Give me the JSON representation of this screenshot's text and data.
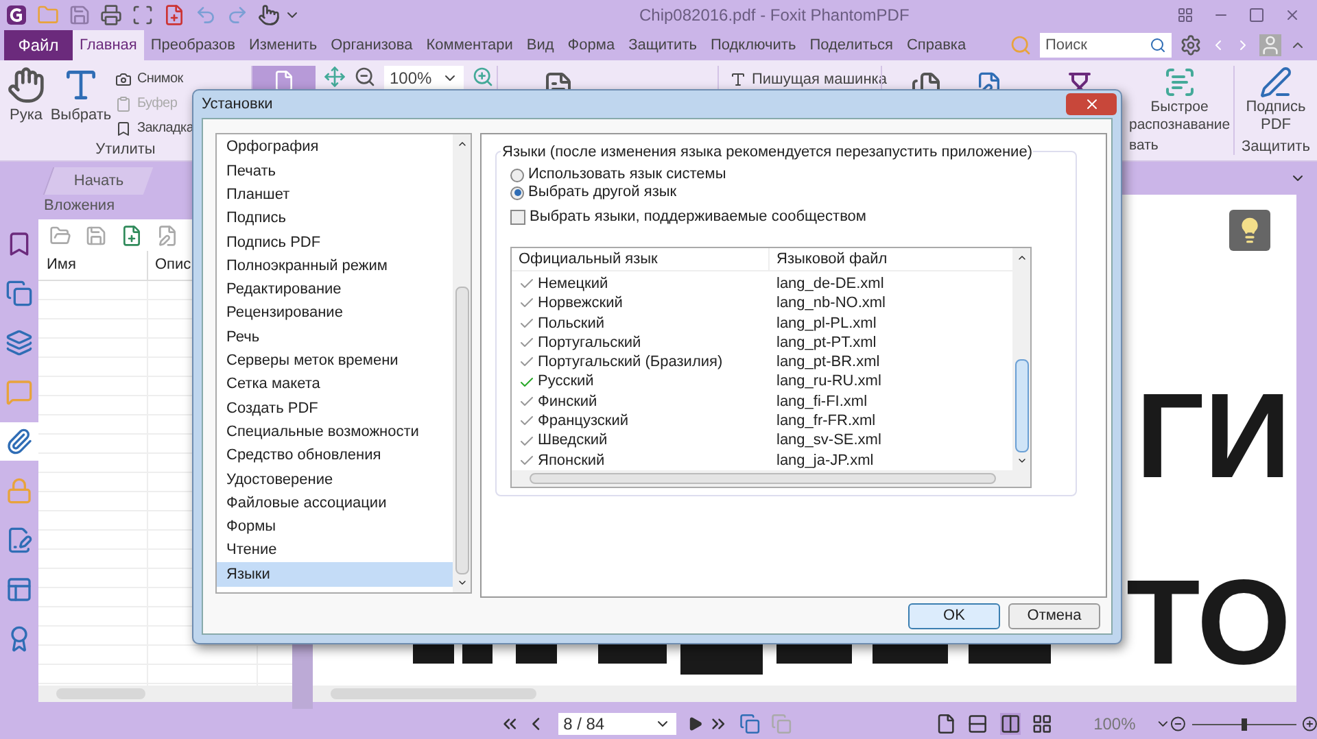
{
  "window": {
    "title": "Chip082016.pdf - Foxit PhantomPDF"
  },
  "menu_tabs": [
    {
      "label": "Файл",
      "kind": "file",
      "selected": false
    },
    {
      "label": "Главная",
      "kind": "tab",
      "selected": true
    },
    {
      "label": "Преобразов",
      "kind": "tab",
      "selected": false
    },
    {
      "label": "Изменить",
      "kind": "tab",
      "selected": false
    },
    {
      "label": "Организова",
      "kind": "tab",
      "selected": false
    },
    {
      "label": "Комментари",
      "kind": "tab",
      "selected": false
    },
    {
      "label": "Вид",
      "kind": "tab",
      "selected": false
    },
    {
      "label": "Форма",
      "kind": "tab",
      "selected": false
    },
    {
      "label": "Защитить",
      "kind": "tab",
      "selected": false
    },
    {
      "label": "Подключить",
      "kind": "tab",
      "selected": false
    },
    {
      "label": "Поделиться",
      "kind": "tab",
      "selected": false
    },
    {
      "label": "Справка",
      "kind": "tab",
      "selected": false
    }
  ],
  "search": {
    "placeholder": "Поиск"
  },
  "ribbon": {
    "hand": "Рука",
    "select": "Выбрать",
    "small_tools": [
      {
        "label": "Снимок",
        "disabled": false
      },
      {
        "label": "Буфер",
        "disabled": true
      },
      {
        "label": "Закладка",
        "disabled": false
      }
    ],
    "utilities_group": "Утилиты",
    "zoom": "100%",
    "typewriter": "Пишущая машинка",
    "ocr_lines": [
      "Быстрое",
      "распознавание"
    ],
    "recognize_group": "вать",
    "sign_lines": [
      "Подпись",
      "PDF"
    ],
    "protect_group": "Защитить"
  },
  "doc_tab": {
    "label": "Начать"
  },
  "sidebar": {
    "items": [
      {
        "kind": "bookmarks",
        "selected": false
      },
      {
        "kind": "pages",
        "selected": false
      },
      {
        "kind": "layers",
        "selected": false
      },
      {
        "kind": "comments",
        "selected": false
      },
      {
        "kind": "attachments",
        "selected": true
      },
      {
        "kind": "security",
        "selected": false
      },
      {
        "kind": "signatures",
        "selected": false
      },
      {
        "kind": "forms",
        "selected": false
      },
      {
        "kind": "certify",
        "selected": false
      }
    ]
  },
  "panel": {
    "title": "Вложения",
    "columns": [
      "Имя",
      "Опис"
    ]
  },
  "document": {
    "lines": [
      "ГИ",
      "ТО"
    ]
  },
  "dialog": {
    "title": "Установки",
    "categories": [
      {
        "label": "Орфография",
        "selected": false
      },
      {
        "label": "Печать",
        "selected": false
      },
      {
        "label": "Планшет",
        "selected": false
      },
      {
        "label": "Подпись",
        "selected": false
      },
      {
        "label": "Подпись PDF",
        "selected": false
      },
      {
        "label": "Полноэкранный режим",
        "selected": false
      },
      {
        "label": "Редактирование",
        "selected": false
      },
      {
        "label": "Рецензирование",
        "selected": false
      },
      {
        "label": "Речь",
        "selected": false
      },
      {
        "label": "Серверы меток времени",
        "selected": false
      },
      {
        "label": "Сетка макета",
        "selected": false
      },
      {
        "label": "Создать PDF",
        "selected": false
      },
      {
        "label": "Специальные возможности",
        "selected": false
      },
      {
        "label": "Средство обновления",
        "selected": false
      },
      {
        "label": "Удостоверение",
        "selected": false
      },
      {
        "label": "Файловые ассоциации",
        "selected": false
      },
      {
        "label": "Формы",
        "selected": false
      },
      {
        "label": "Чтение",
        "selected": false
      },
      {
        "label": "Языки",
        "selected": true
      }
    ],
    "group_title": "Языки (после изменения языка рекомендуется перезапустить приложение)",
    "radios": [
      {
        "label": "Использовать язык системы",
        "selected": false
      },
      {
        "label": "Выбрать другой язык",
        "selected": true
      }
    ],
    "community_checkbox": {
      "label": "Выбрать языки, поддерживаемые сообществом",
      "checked": false
    },
    "table": {
      "columns": [
        "Официальный язык",
        "Языковой файл"
      ],
      "rows": [
        {
          "language": "Немецкий",
          "file": "lang_de-DE.xml",
          "active": false
        },
        {
          "language": "Норвежский",
          "file": "lang_nb-NO.xml",
          "active": false
        },
        {
          "language": "Польский",
          "file": "lang_pl-PL.xml",
          "active": false
        },
        {
          "language": "Португальский",
          "file": "lang_pt-PT.xml",
          "active": false
        },
        {
          "language": "Португальский (Бразилия)",
          "file": "lang_pt-BR.xml",
          "active": false
        },
        {
          "language": "Русский",
          "file": "lang_ru-RU.xml",
          "active": true
        },
        {
          "language": "Финский",
          "file": "lang_fi-FI.xml",
          "active": false
        },
        {
          "language": "Французский",
          "file": "lang_fr-FR.xml",
          "active": false
        },
        {
          "language": "Шведский",
          "file": "lang_sv-SE.xml",
          "active": false
        },
        {
          "language": "Японский",
          "file": "lang_ja-JP.xml",
          "active": false
        }
      ]
    },
    "buttons": [
      {
        "label": "OK",
        "default": true
      },
      {
        "label": "Отмена",
        "default": false
      }
    ]
  },
  "status_bar": {
    "page": "8 / 84",
    "zoom": "100%",
    "zoom_slider": {
      "level": 0.5
    }
  }
}
